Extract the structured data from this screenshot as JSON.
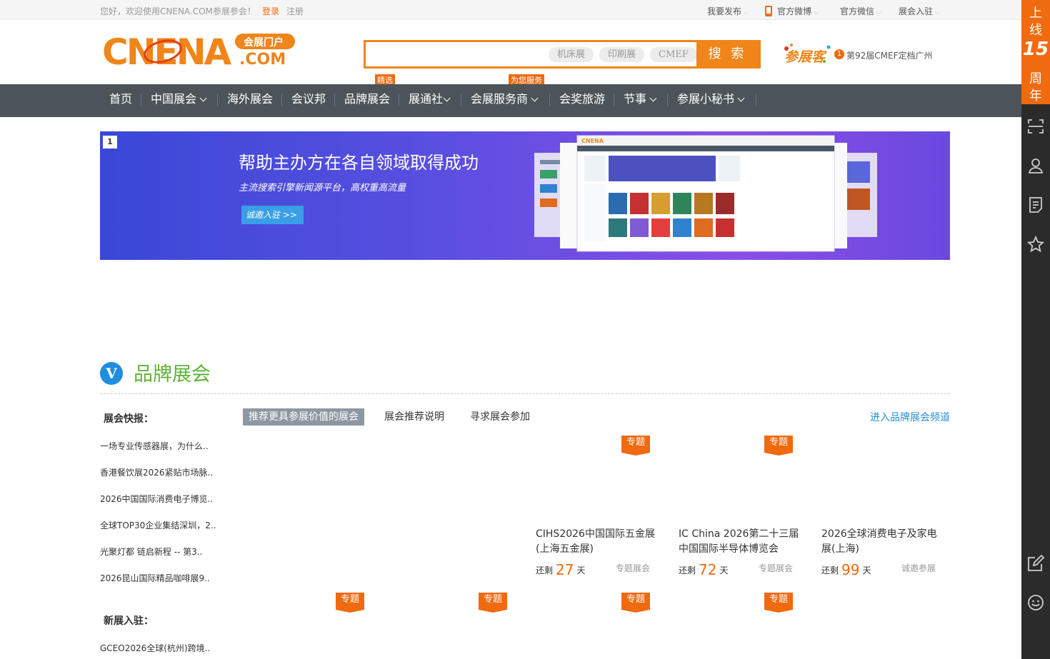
{
  "topbar": {
    "welcome": "您好，欢迎使用CNENA.COM参展参会！",
    "login": "登录",
    "register": "注册",
    "links": [
      {
        "label": "我要发布",
        "caret": "⌵"
      },
      {
        "label": "官方微博",
        "caret": "⌵"
      },
      {
        "label": "官方微信",
        "caret": "⌵"
      },
      {
        "label": "展会入驻",
        "caret": "⌵"
      }
    ]
  },
  "header": {
    "logo_text": "CNENA",
    "logo_badge": "会展门户",
    "logo_domain": ".COM",
    "search": {
      "placeholder": "",
      "tags": [
        "机床展",
        "印刷展",
        "CMEF"
      ],
      "button": "搜 索"
    },
    "canzhan_logo": "参展客",
    "notice_count": "1",
    "notice_text": "第92届CMEF定档广州"
  },
  "nav": {
    "items": [
      {
        "label": "首页"
      },
      {
        "label": "中国展会"
      },
      {
        "label": "海外展会"
      },
      {
        "label": "会议邦"
      },
      {
        "label": "品牌展会"
      },
      {
        "label": "展通社"
      },
      {
        "label": "会展服务商"
      },
      {
        "label": "会奖旅游"
      },
      {
        "label": "节事"
      },
      {
        "label": "参展小秘书"
      }
    ],
    "tags": [
      "精选",
      "为您服务"
    ]
  },
  "banner": {
    "index": "1",
    "title": "帮助主办方在各自领域取得成功",
    "subtitle": "主流搜索引擎新闻源平台，高权重高流量",
    "button": "诚邀入驻 >>"
  },
  "brand_section": {
    "icon_letter": "V",
    "title": "品牌展会",
    "quick_label": "展会快报：",
    "tabs": [
      "推荐更具参展价值的展会",
      "展会推荐说明",
      "寻求展会参加"
    ],
    "enter_link": "进入品牌展会频道",
    "news": [
      "一场专业传感器展，为什么..",
      "香港餐饮展2026紧贴市场脉..",
      "2026中国国际消费电子博览..",
      "全球TOP30企业集结深圳，2..",
      "光聚灯都 链启新程 -- 第3..",
      "2026昆山国际精品咖啡展9.."
    ],
    "new_label": "新展入驻：",
    "new_items": [
      "GCEO2026全球(杭州)跨境.."
    ],
    "ribbon_label": "专题",
    "remaining_prefix": "还剩",
    "days_unit": "天",
    "cards": [
      {
        "title": "CIHS2026中国国际五金展(上海五金展)",
        "days": "27",
        "category": "专题展会"
      },
      {
        "title": "IC China 2026第二十三届中国国际半导体博览会",
        "days": "72",
        "category": "专题展会"
      },
      {
        "title": "2026全球消费电子及家电展(上海)",
        "days": "99",
        "category": "诚邀参展"
      }
    ]
  },
  "sidebar": {
    "promo_chars": [
      "上",
      "线",
      "15",
      "周",
      "年"
    ],
    "icons": [
      "scan-icon",
      "user-icon",
      "document-icon",
      "star-icon",
      "edit-icon",
      "smile-icon"
    ]
  },
  "colors": {
    "accent": "#f06a0f",
    "nav_bg": "#4d5459",
    "section_green": "#5fb337",
    "link_blue": "#2a8fd5"
  }
}
